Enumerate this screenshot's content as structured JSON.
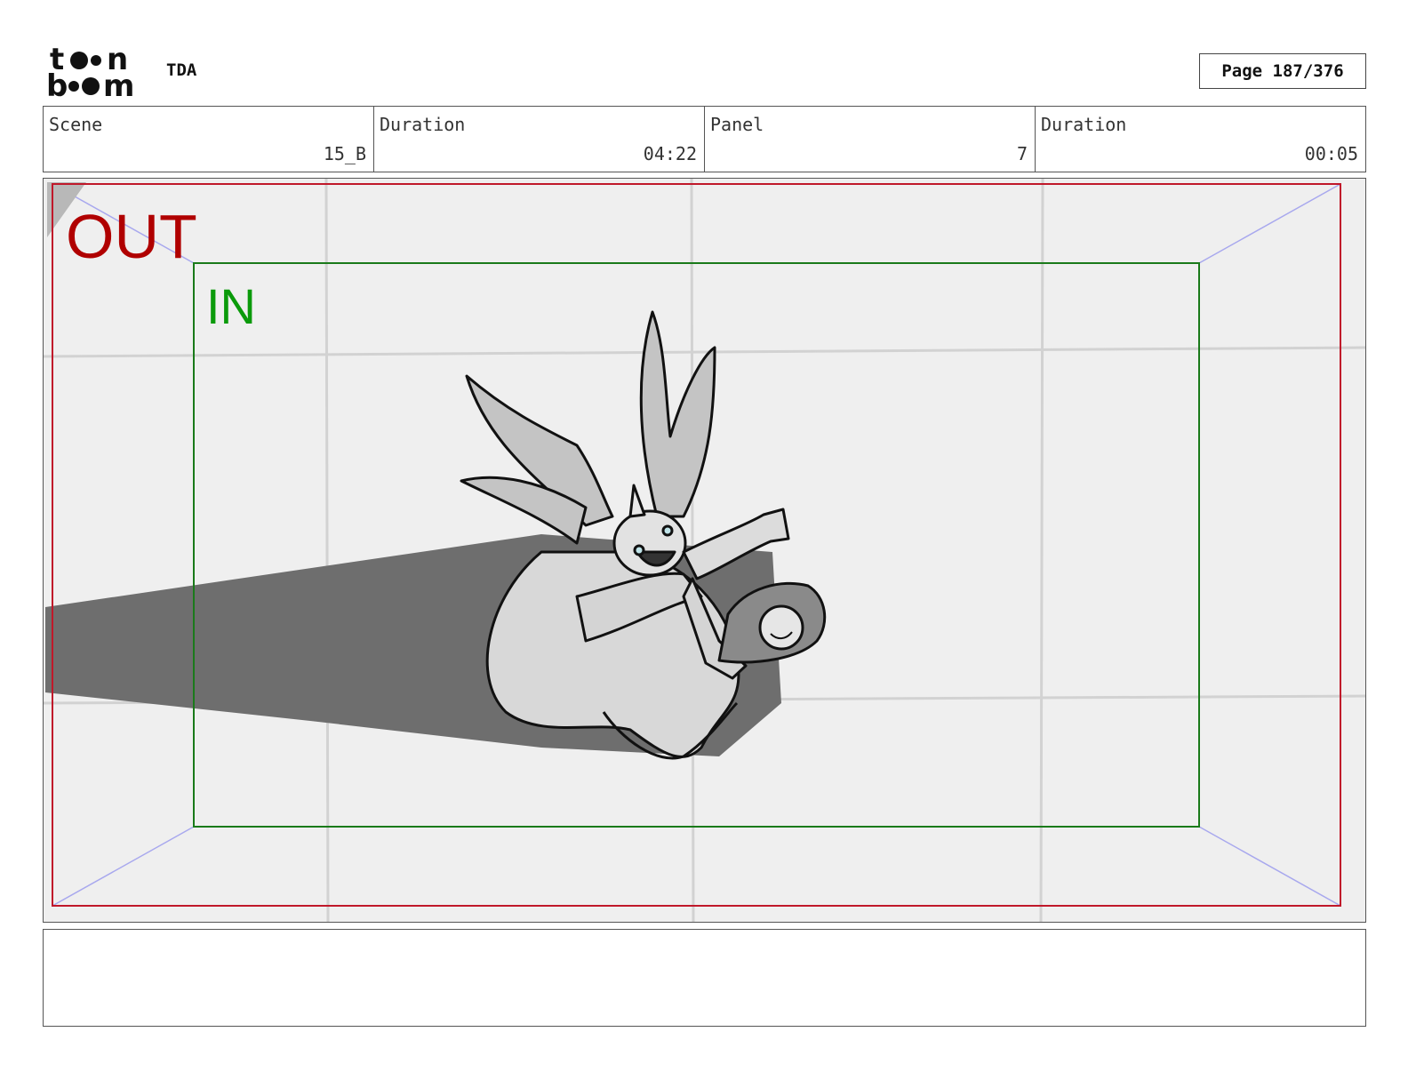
{
  "header": {
    "logo_text": "toon boom",
    "project": "TDA",
    "page_label": "Page 187/376"
  },
  "info": {
    "scene_label": "Scene",
    "scene_value": "15_B",
    "scene_duration_label": "Duration",
    "scene_duration_value": "04:22",
    "panel_label": "Panel",
    "panel_value": "7",
    "panel_duration_label": "Duration",
    "panel_duration_value": "00:05"
  },
  "panel": {
    "out_label": "OUT",
    "in_label": "IN",
    "colors": {
      "out_frame": "#c0182a",
      "in_frame": "#1a7a1a",
      "camera_lines": "#9999e6",
      "grid": "#d0d0d0",
      "shadow": "#6e6e6e"
    }
  },
  "notes": {
    "text": ""
  }
}
